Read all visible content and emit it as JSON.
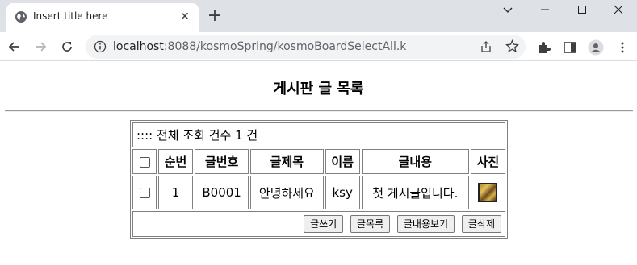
{
  "browser": {
    "tab_title": "Insert title here",
    "url_host": "localhost",
    "url_rest": ":8088/kosmoSpring/kosmoBoardSelectAll.k"
  },
  "page": {
    "heading": "게시판 글 목록",
    "count_label": ":::: 전체 조회 건수 1 건",
    "columns": [
      "순번",
      "글번호",
      "글제목",
      "이름",
      "글내용",
      "사진"
    ],
    "rows": [
      {
        "seq": "1",
        "board_no": "B0001",
        "subject": "안녕하세요",
        "name": "ksy",
        "content": "첫 게시글입니다."
      }
    ],
    "buttons": {
      "write": "글쓰기",
      "list": "글목록",
      "view": "글내용보기",
      "delete": "글삭제"
    }
  }
}
